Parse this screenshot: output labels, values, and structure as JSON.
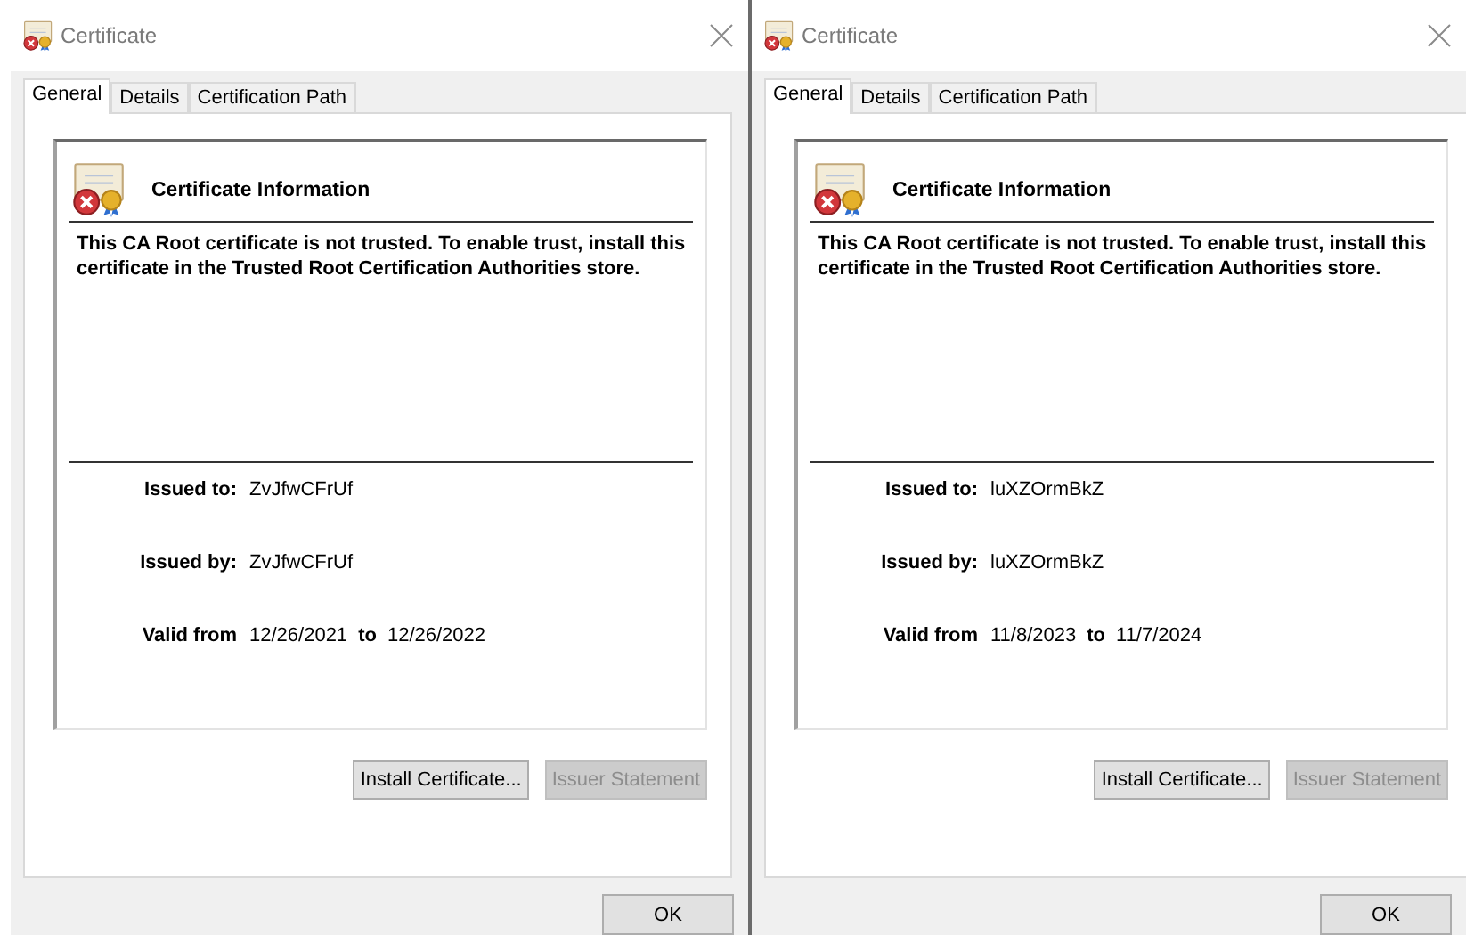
{
  "dialogs": [
    {
      "title": "Certificate",
      "tabs": [
        {
          "label": "General",
          "selected": true
        },
        {
          "label": "Details",
          "selected": false
        },
        {
          "label": "Certification Path",
          "selected": false
        }
      ],
      "header": "Certificate Information",
      "message": "This CA Root certificate is not trusted. To enable trust, install this certificate in the Trusted Root Certification Authorities store.",
      "issued_to": {
        "label": "Issued to:",
        "value": "ZvJfwCFrUf"
      },
      "issued_by": {
        "label": "Issued by:",
        "value": "ZvJfwCFrUf"
      },
      "validity": {
        "label": "Valid from",
        "from": "12/26/2021",
        "to_label": "to",
        "to": "12/26/2022"
      },
      "buttons": [
        {
          "label": "Install Certificate...",
          "disabled": false
        },
        {
          "label": "Issuer Statement",
          "disabled": true
        }
      ],
      "ok": "OK"
    },
    {
      "title": "Certificate",
      "tabs": [
        {
          "label": "General",
          "selected": true
        },
        {
          "label": "Details",
          "selected": false
        },
        {
          "label": "Certification Path",
          "selected": false
        }
      ],
      "header": "Certificate Information",
      "message": "This CA Root certificate is not trusted. To enable trust, install this certificate in the Trusted Root Certification Authorities store.",
      "issued_to": {
        "label": "Issued to:",
        "value": "luXZOrmBkZ"
      },
      "issued_by": {
        "label": "Issued by:",
        "value": "luXZOrmBkZ"
      },
      "validity": {
        "label": "Valid from",
        "from": "11/8/2023",
        "to_label": "to",
        "to": "11/7/2024"
      },
      "buttons": [
        {
          "label": "Install Certificate...",
          "disabled": false
        },
        {
          "label": "Issuer Statement",
          "disabled": true
        }
      ],
      "ok": "OK"
    }
  ]
}
